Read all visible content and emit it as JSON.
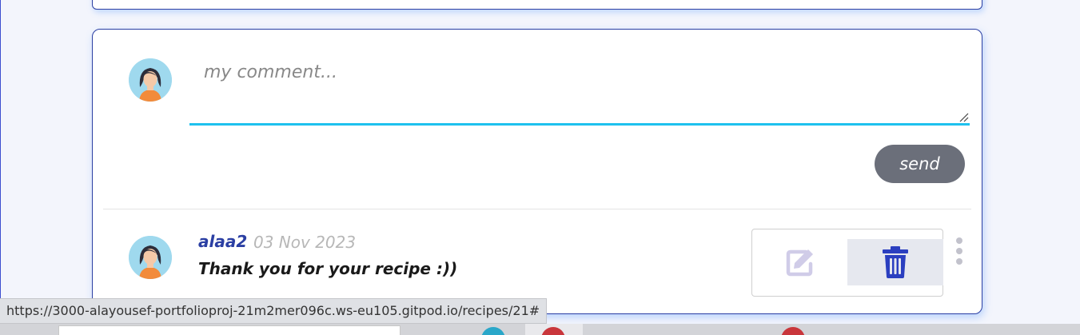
{
  "composer": {
    "placeholder": "my comment...",
    "send_label": "send"
  },
  "comment": {
    "author": "alaa2",
    "date": "03 Nov 2023",
    "text": "Thank you for your recipe :))"
  },
  "status_bar": {
    "url": "https://3000-alayousef-portfolioproj-21m2mer096c.ws-eu105.gitpod.io/recipes/21#"
  },
  "icons": {
    "avatar": "woman-avatar-icon",
    "edit": "edit-icon",
    "delete": "trash-icon",
    "more": "kebab-menu-icon"
  },
  "colors": {
    "accent_blue": "#2b3fa3",
    "input_underline": "#1ec1ee",
    "send_button": "#6b6f7a",
    "date_gray": "#b7b7b7",
    "edit_icon": "#d0cce8",
    "delete_icon": "#2b3fc0"
  }
}
